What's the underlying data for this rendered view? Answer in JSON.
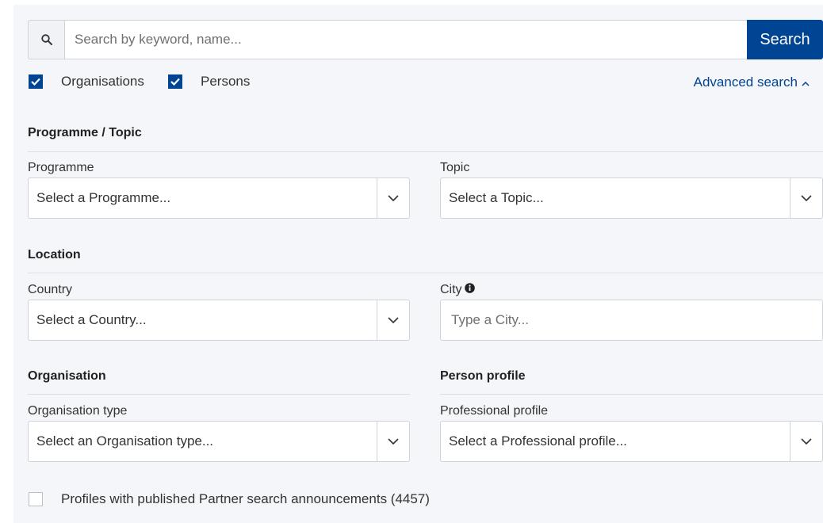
{
  "search": {
    "placeholder": "Search by keyword, name...",
    "button_label": "Search",
    "icon": "search-icon"
  },
  "filters": {
    "organisations": {
      "label": "Organisations",
      "checked": true
    },
    "persons": {
      "label": "Persons",
      "checked": true
    },
    "advanced_link": "Advanced search",
    "advanced_icon": "chevron-up-icon"
  },
  "programme_topic": {
    "title": "Programme / Topic",
    "programme": {
      "label": "Programme",
      "value": "Select a Programme..."
    },
    "topic": {
      "label": "Topic",
      "value": "Select a Topic..."
    }
  },
  "location": {
    "title": "Location",
    "country": {
      "label": "Country",
      "value": "Select a Country..."
    },
    "city": {
      "label": "City",
      "placeholder": "Type a City...",
      "icon": "info-icon"
    }
  },
  "organisation": {
    "title": "Organisation",
    "type": {
      "label": "Organisation type",
      "value": "Select an Organisation type..."
    }
  },
  "person_profile": {
    "title": "Person profile",
    "professional": {
      "label": "Professional profile",
      "value": "Select a Professional profile..."
    }
  },
  "partner_search": {
    "label": "Profiles with published Partner search announcements (4457)",
    "checked": false
  },
  "colors": {
    "primary": "#004494",
    "panel_bg": "#f5f6f9",
    "border": "#cfd3da"
  }
}
